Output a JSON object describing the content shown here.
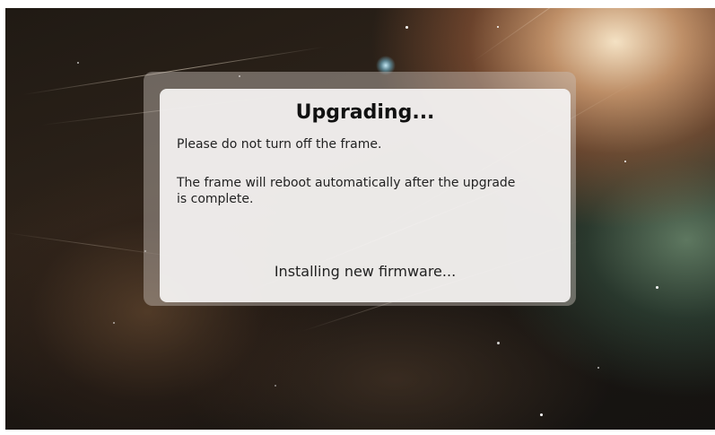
{
  "dialog": {
    "title": "Upgrading...",
    "warning": "Please do not turn off the frame.",
    "info": "The frame will reboot automatically after the upgrade is complete.",
    "status": "Installing new firmware..."
  }
}
